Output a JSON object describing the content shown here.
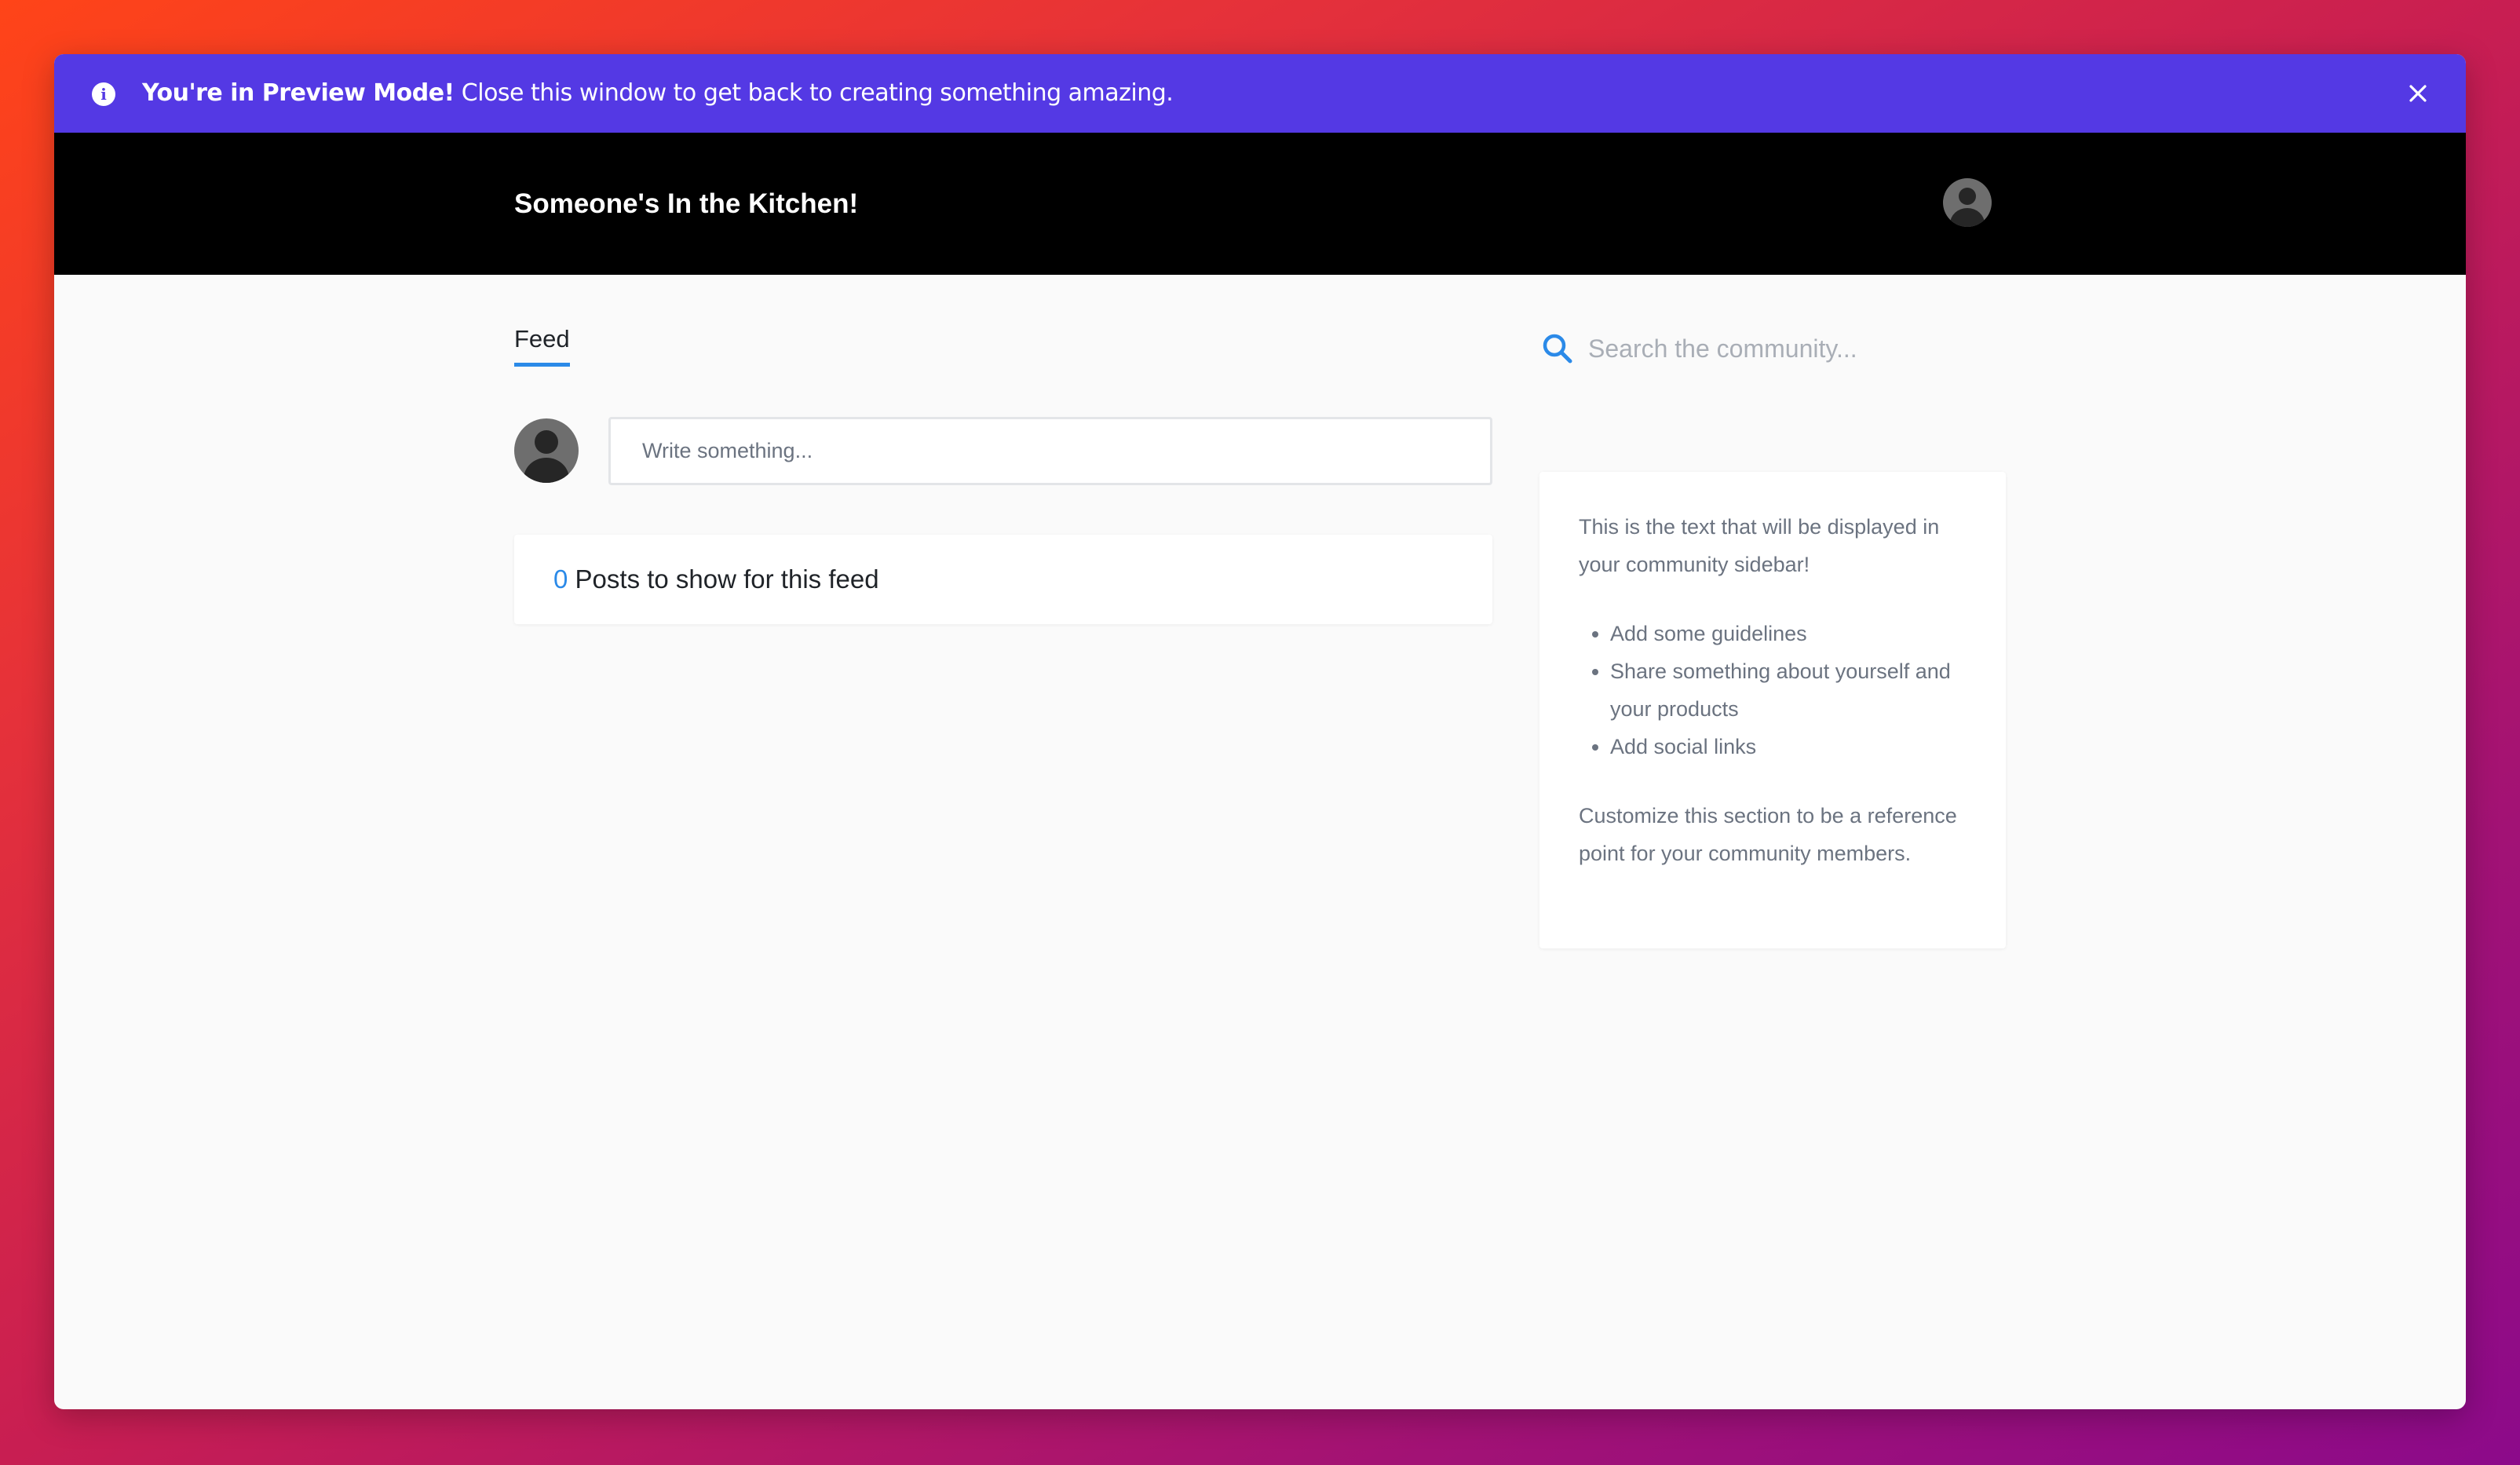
{
  "banner": {
    "strong_text": "You're in Preview Mode!",
    "rest_text": "Close this window to get back to creating something amazing.",
    "info_icon": "info-icon",
    "close_icon": "close-icon",
    "background_color": "#5439e4"
  },
  "header": {
    "title": "Someone's In the Kitchen!",
    "avatar_icon": "user-avatar"
  },
  "feed": {
    "tab_label": "Feed",
    "composer_placeholder": "Write something...",
    "posts_count": "0",
    "posts_text": "Posts to show for this feed"
  },
  "search": {
    "placeholder": "Search the community...",
    "icon": "search-icon"
  },
  "sidebar": {
    "intro": "This is the text that will be displayed in your community sidebar!",
    "items": [
      "Add some guidelines",
      "Share something about yourself and your products",
      "Add social links"
    ],
    "outro": "Customize this section to be a reference point for your community members."
  },
  "colors": {
    "accent": "#2b8ae8",
    "header_bg": "#000000",
    "page_bg": "#fafafa"
  }
}
